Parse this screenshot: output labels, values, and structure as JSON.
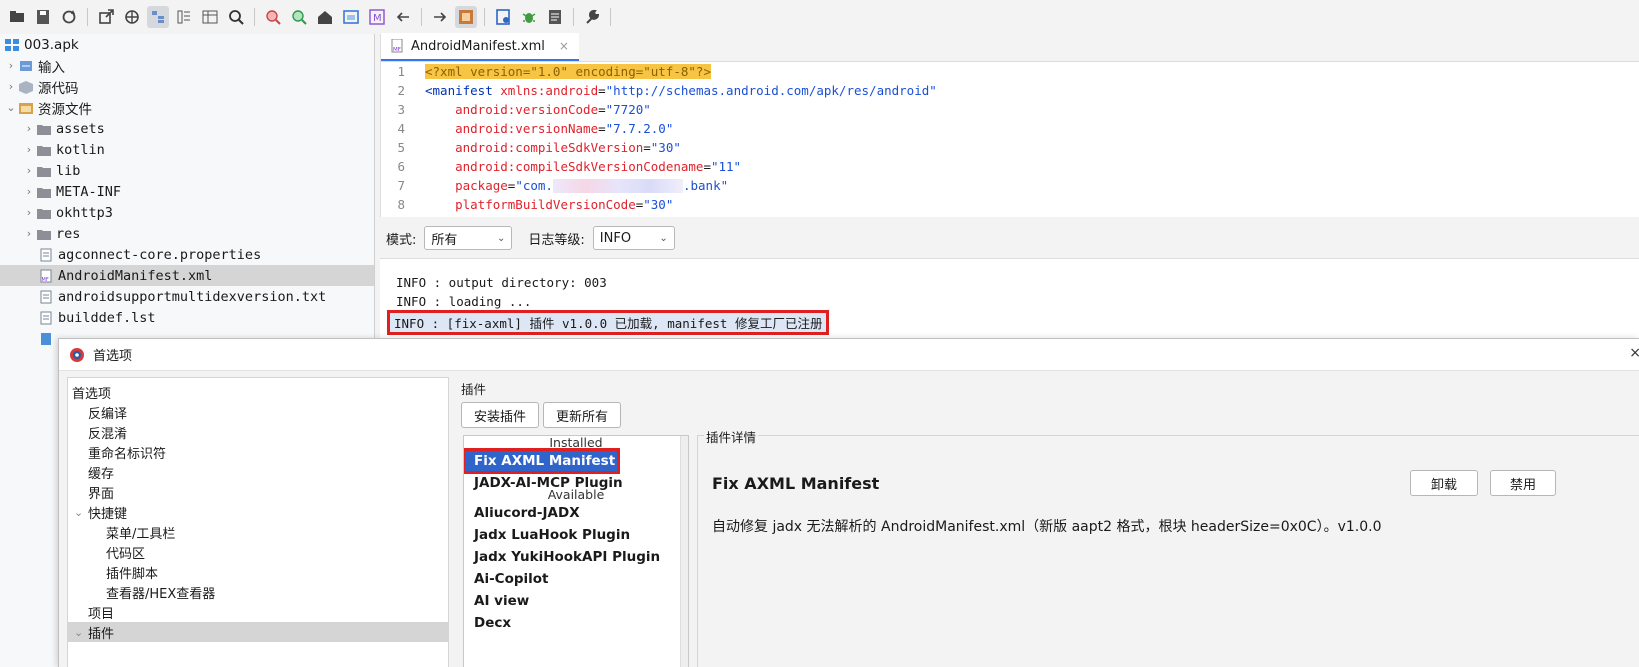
{
  "toolbar": {
    "buttons": [
      "open-icon",
      "save-icon",
      "refresh-icon",
      "export-icon",
      "sync-icon",
      "tree-icon",
      "flatten-icon",
      "table-icon",
      "search-icon",
      "find-usage-icon",
      "find-icon",
      "home-icon",
      "window-icon",
      "m-icon",
      "back-icon",
      "forward-icon",
      "decompile-icon",
      "bookmark-icon",
      "debug-icon",
      "log-icon",
      "settings-wrench-icon"
    ]
  },
  "tree": {
    "root": "003.apk",
    "items": [
      {
        "label": "输入",
        "depth": 1,
        "expandable": true,
        "icon": "input-icon"
      },
      {
        "label": "源代码",
        "depth": 1,
        "expandable": true,
        "icon": "package-icon"
      },
      {
        "label": "资源文件",
        "depth": 1,
        "expandable": true,
        "expanded": true,
        "icon": "resources-icon"
      },
      {
        "label": "assets",
        "depth": 2,
        "expandable": true,
        "icon": "folder-icon"
      },
      {
        "label": "kotlin",
        "depth": 2,
        "expandable": true,
        "icon": "folder-icon"
      },
      {
        "label": "lib",
        "depth": 2,
        "expandable": true,
        "icon": "folder-icon"
      },
      {
        "label": "META-INF",
        "depth": 2,
        "expandable": true,
        "icon": "folder-icon"
      },
      {
        "label": "okhttp3",
        "depth": 2,
        "expandable": true,
        "icon": "folder-icon"
      },
      {
        "label": "res",
        "depth": 2,
        "expandable": true,
        "icon": "folder-icon"
      },
      {
        "label": "agconnect-core.properties",
        "depth": 2,
        "expandable": false,
        "icon": "file-icon"
      },
      {
        "label": "AndroidManifest.xml",
        "depth": 2,
        "expandable": false,
        "icon": "manifest-icon",
        "selected": true
      },
      {
        "label": "androidsupportmultidexversion.txt",
        "depth": 2,
        "expandable": false,
        "icon": "file-icon"
      },
      {
        "label": "builddef.lst",
        "depth": 2,
        "expandable": false,
        "icon": "file-icon"
      }
    ]
  },
  "editor": {
    "tab_label": "AndroidManifest.xml",
    "close": "×",
    "lines": [
      {
        "n": "1",
        "parts": [
          {
            "t": "<?xml version=\"1.0\" encoding=\"utf-8\"?>",
            "c": "pi"
          }
        ]
      },
      {
        "n": "2",
        "parts": [
          {
            "t": "<manifest ",
            "c": "tag"
          },
          {
            "t": "xmlns:android",
            "c": "attr"
          },
          {
            "t": "=",
            "c": "plain"
          },
          {
            "t": "\"http://schemas.android.com/apk/res/android\"",
            "c": "val2"
          }
        ]
      },
      {
        "n": "3",
        "parts": [
          {
            "t": "    android:versionCode",
            "c": "attr"
          },
          {
            "t": "=",
            "c": "plain"
          },
          {
            "t": "\"7720\"",
            "c": "val2"
          }
        ]
      },
      {
        "n": "4",
        "parts": [
          {
            "t": "    android:versionName",
            "c": "attr"
          },
          {
            "t": "=",
            "c": "plain"
          },
          {
            "t": "\"7.7.2.0\"",
            "c": "val2"
          }
        ]
      },
      {
        "n": "5",
        "parts": [
          {
            "t": "    android:compileSdkVersion",
            "c": "attr"
          },
          {
            "t": "=",
            "c": "plain"
          },
          {
            "t": "\"30\"",
            "c": "val2"
          }
        ]
      },
      {
        "n": "6",
        "parts": [
          {
            "t": "    android:compileSdkVersionCodename",
            "c": "attr"
          },
          {
            "t": "=",
            "c": "plain"
          },
          {
            "t": "\"11\"",
            "c": "val2"
          }
        ]
      },
      {
        "n": "7",
        "parts": [
          {
            "t": "    package",
            "c": "attr"
          },
          {
            "t": "=",
            "c": "plain"
          },
          {
            "t": "\"com.",
            "c": "val2"
          },
          {
            "t": "",
            "c": "blur"
          },
          {
            "t": ".bank\"",
            "c": "val2"
          }
        ]
      },
      {
        "n": "8",
        "parts": [
          {
            "t": "    platformBuildVersionCode",
            "c": "attr"
          },
          {
            "t": "=",
            "c": "plain"
          },
          {
            "t": "\"30\"",
            "c": "val2"
          }
        ]
      }
    ]
  },
  "logbar": {
    "mode_label": "模式:",
    "mode_value": "所有",
    "level_label": "日志等级:",
    "level_value": "INFO"
  },
  "log": {
    "lines": [
      "INFO : output directory: 003",
      "INFO : loading ...",
      "INFO : [fix-axml] 插件 v1.0.0 已加载, manifest 修复工厂已注册"
    ]
  },
  "prefs": {
    "title": "首选项",
    "close": "×",
    "nav": [
      {
        "label": "首选项",
        "depth": 0
      },
      {
        "label": "反编译",
        "depth": 1
      },
      {
        "label": "反混淆",
        "depth": 1
      },
      {
        "label": "重命名标识符",
        "depth": 1
      },
      {
        "label": "缓存",
        "depth": 1
      },
      {
        "label": "界面",
        "depth": 1
      },
      {
        "label": "快捷键",
        "depth": 1,
        "expanded": true
      },
      {
        "label": "菜单/工具栏",
        "depth": 2
      },
      {
        "label": "代码区",
        "depth": 2
      },
      {
        "label": "插件脚本",
        "depth": 2
      },
      {
        "label": "查看器/HEX查看器",
        "depth": 2
      },
      {
        "label": "项目",
        "depth": 1
      },
      {
        "label": "插件",
        "depth": 1,
        "expanded": true,
        "selected": true
      }
    ],
    "plugins": {
      "group_title": "插件",
      "install_button": "安装插件",
      "update_all_button": "更新所有",
      "installed_header": "Installed",
      "installed": [
        "Fix AXML Manifest",
        "JADX-AI-MCP Plugin"
      ],
      "available_header": "Available",
      "available": [
        "Aliucord-JADX",
        "Jadx LuaHook Plugin",
        "Jadx YukiHookAPI Plugin",
        "Ai-Copilot",
        "AI view",
        "Decx"
      ]
    },
    "detail": {
      "legend": "插件详情",
      "name": "Fix AXML Manifest",
      "description": "自动修复 jadx 无法解析的 AndroidManifest.xml（新版 aapt2 格式，根块 headerSize=0x0C）。v1.0.0",
      "uninstall_button": "卸载",
      "disable_button": "禁用"
    }
  },
  "colors": {
    "accent": "#3574f0",
    "selection_blue": "#2f65ca",
    "highlight_red": "#e02020"
  }
}
